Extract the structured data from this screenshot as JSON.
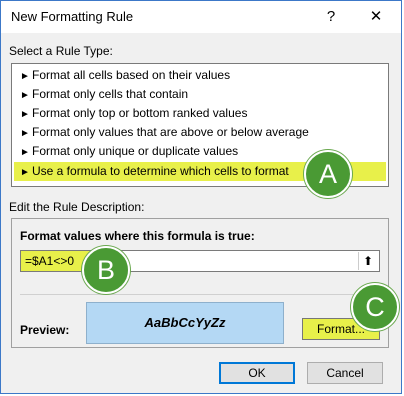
{
  "window": {
    "title": "New Formatting Rule",
    "help_label": "?",
    "close_label": "✕"
  },
  "rule_type": {
    "label": "Select a Rule Type:",
    "arrow": "►",
    "items": [
      {
        "label": "Format all cells based on their values",
        "selected": false
      },
      {
        "label": "Format only cells that contain",
        "selected": false
      },
      {
        "label": "Format only top or bottom ranked values",
        "selected": false
      },
      {
        "label": "Format only values that are above or below average",
        "selected": false
      },
      {
        "label": "Format only unique or duplicate values",
        "selected": false
      },
      {
        "label": "Use a formula to determine which cells to format",
        "selected": true
      }
    ]
  },
  "description": {
    "label": "Edit the Rule Description:",
    "formula_label": "Format values where this formula is true:",
    "formula_value": "=$A1<>0",
    "collapse_icon": "⬆",
    "preview_label": "Preview:",
    "preview_sample": "AaBbCcYyZz",
    "format_button": "Format..."
  },
  "buttons": {
    "ok": "OK",
    "cancel": "Cancel"
  },
  "callouts": {
    "a": "A",
    "b": "B",
    "c": "C"
  },
  "colors": {
    "highlight": "#e8f04a",
    "callout": "#4a9a34",
    "preview_fill": "#b4d8f4"
  }
}
